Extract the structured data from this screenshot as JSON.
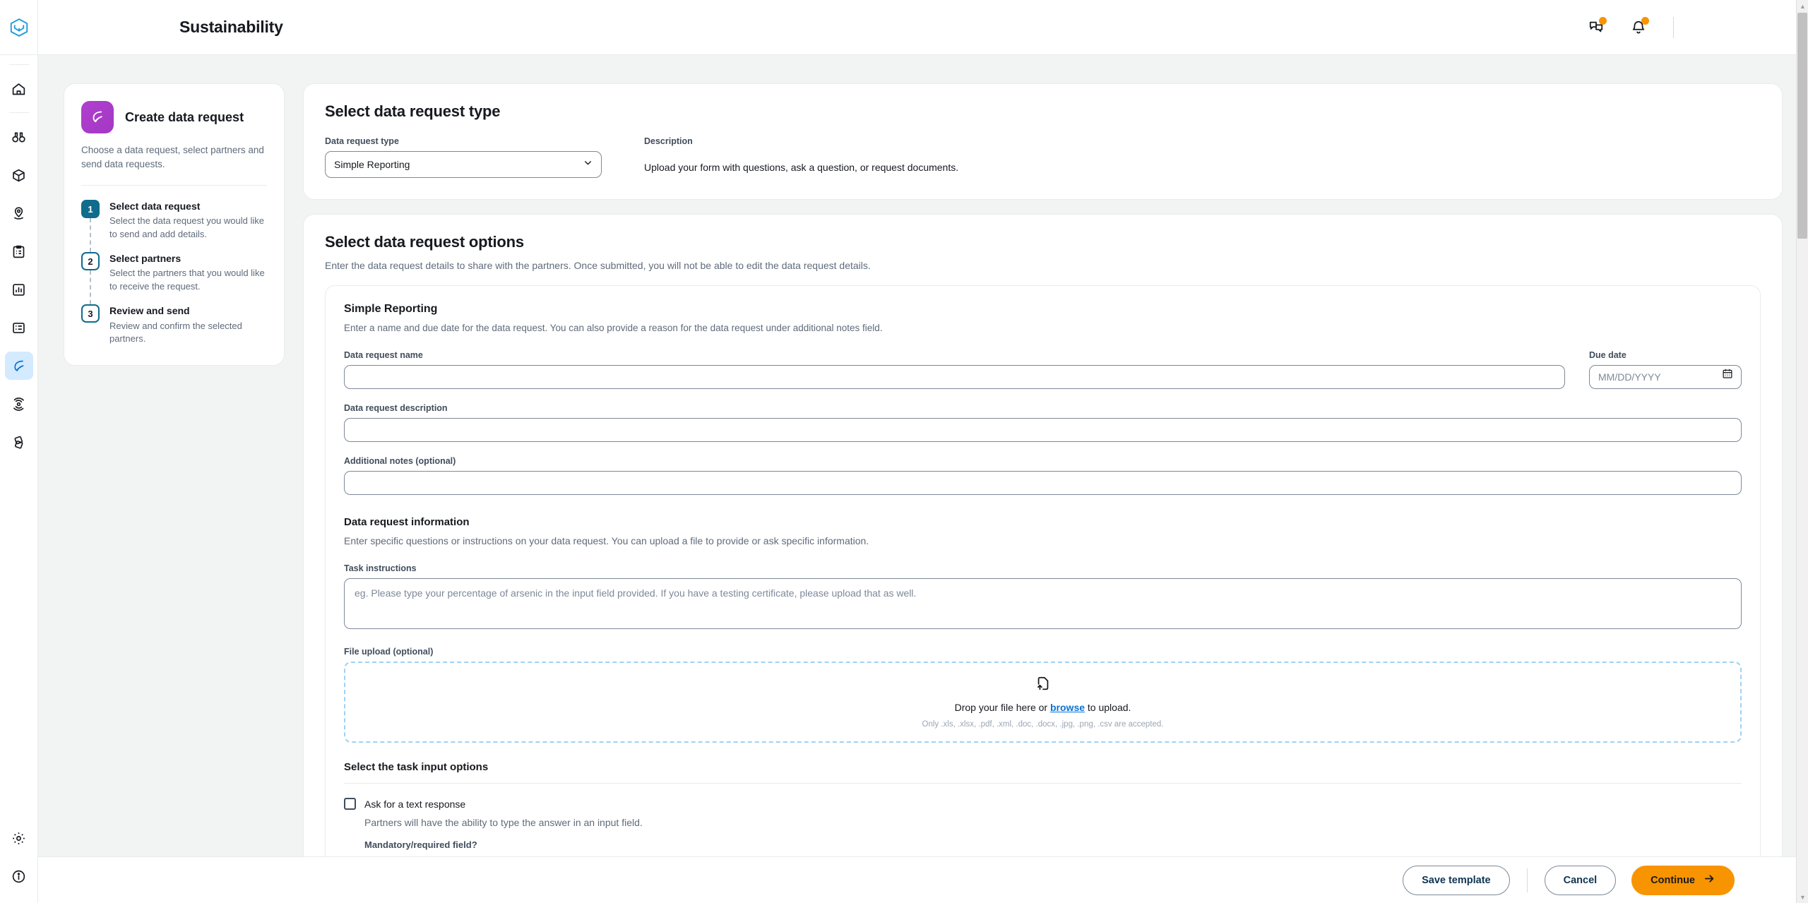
{
  "header": {
    "title": "Sustainability",
    "logo_icon": "cube-logo-icon",
    "chat_icon": "chat-bubbles-icon",
    "bell_icon": "notification-bell-icon",
    "accent_orange": "#f79400"
  },
  "sidebar": {
    "items": [
      {
        "icon": "home-icon",
        "name": "sidebar-item-home",
        "active": false
      },
      {
        "icon": "binoculars-icon",
        "name": "sidebar-item-discover",
        "active": false
      },
      {
        "icon": "package-icon",
        "name": "sidebar-item-products",
        "active": false
      },
      {
        "icon": "map-pin-icon",
        "name": "sidebar-item-locations",
        "active": false
      },
      {
        "icon": "clipboard-icon",
        "name": "sidebar-item-tasks",
        "active": false
      },
      {
        "icon": "bar-chart-icon",
        "name": "sidebar-item-analytics",
        "active": false
      },
      {
        "icon": "list-details-icon",
        "name": "sidebar-item-records",
        "active": false
      },
      {
        "icon": "leaf-icon",
        "name": "sidebar-item-sustainability",
        "active": true
      },
      {
        "icon": "target-rings-icon",
        "name": "sidebar-item-goals",
        "active": false
      },
      {
        "icon": "layers-diamond-icon",
        "name": "sidebar-item-integrations",
        "active": false
      }
    ],
    "bottom_items": [
      {
        "icon": "gear-icon",
        "name": "sidebar-item-settings"
      },
      {
        "icon": "info-circle-icon",
        "name": "sidebar-item-help"
      }
    ]
  },
  "wizard": {
    "icon": "leaf-badge-icon",
    "title": "Create data request",
    "subtitle": "Choose a data request, select partners and send data requests.",
    "steps": [
      {
        "number": "1",
        "label": "Select data request",
        "description": "Select the data request you would like to send and add details.",
        "state": "current"
      },
      {
        "number": "2",
        "label": "Select partners",
        "description": "Select the partners that you would like to receive the request.",
        "state": "upcoming"
      },
      {
        "number": "3",
        "label": "Review and send",
        "description": "Review and confirm the selected partners.",
        "state": "upcoming"
      }
    ]
  },
  "type_panel": {
    "title": "Select data request type",
    "field_label": "Data request type",
    "selected_value": "Simple Reporting",
    "options": [
      "Simple Reporting"
    ],
    "chevron_icon": "chevron-down-icon",
    "description_label": "Description",
    "description_text": "Upload your form with questions, ask a question, or request documents."
  },
  "options_panel": {
    "title": "Select data request options",
    "subtitle": "Enter the data request details to share with the partners. Once submitted, you will not be able to edit the data request details.",
    "card": {
      "title": "Simple Reporting",
      "subtitle": "Enter a name and due date for the data request. You can also provide a reason for the data request under additional notes field.",
      "fields": {
        "name_label": "Data request name",
        "name_value": "",
        "name_placeholder": "",
        "due_label": "Due date",
        "due_value": "",
        "due_placeholder": "MM/DD/YYYY",
        "calendar_icon": "calendar-icon",
        "description_label": "Data request description",
        "description_value": "",
        "description_placeholder": "",
        "notes_label": "Additional notes (optional)",
        "notes_value": "",
        "notes_placeholder": ""
      },
      "information": {
        "title": "Data request information",
        "subtitle": "Enter specific questions or instructions on your data request. You can upload a file to provide or ask specific information.",
        "task_label": "Task instructions",
        "task_value": "",
        "task_placeholder": "eg. Please type your percentage of arsenic in the input field provided. If you have a testing certificate, please upload that as well."
      },
      "upload": {
        "label": "File upload (optional)",
        "icon": "file-upload-icon",
        "prompt_before": "Drop your file here or",
        "browse_link": "browse",
        "prompt_after": "to upload.",
        "note": "Only .xls, .xlsx, .pdf, .xml, .doc, .docx, .jpg, .png, .csv are accepted."
      },
      "task_options": {
        "title": "Select the task input options",
        "checkbox_label": "Ask for a text response",
        "checkbox_checked": false,
        "checkbox_description": "Partners will have the ability to type the answer in an input field.",
        "mandatory_label": "Mandatory/required field?"
      }
    }
  },
  "footer": {
    "save_label": "Save template",
    "cancel_label": "Cancel",
    "continue_label": "Continue",
    "continue_arrow_icon": "arrow-right-icon"
  }
}
